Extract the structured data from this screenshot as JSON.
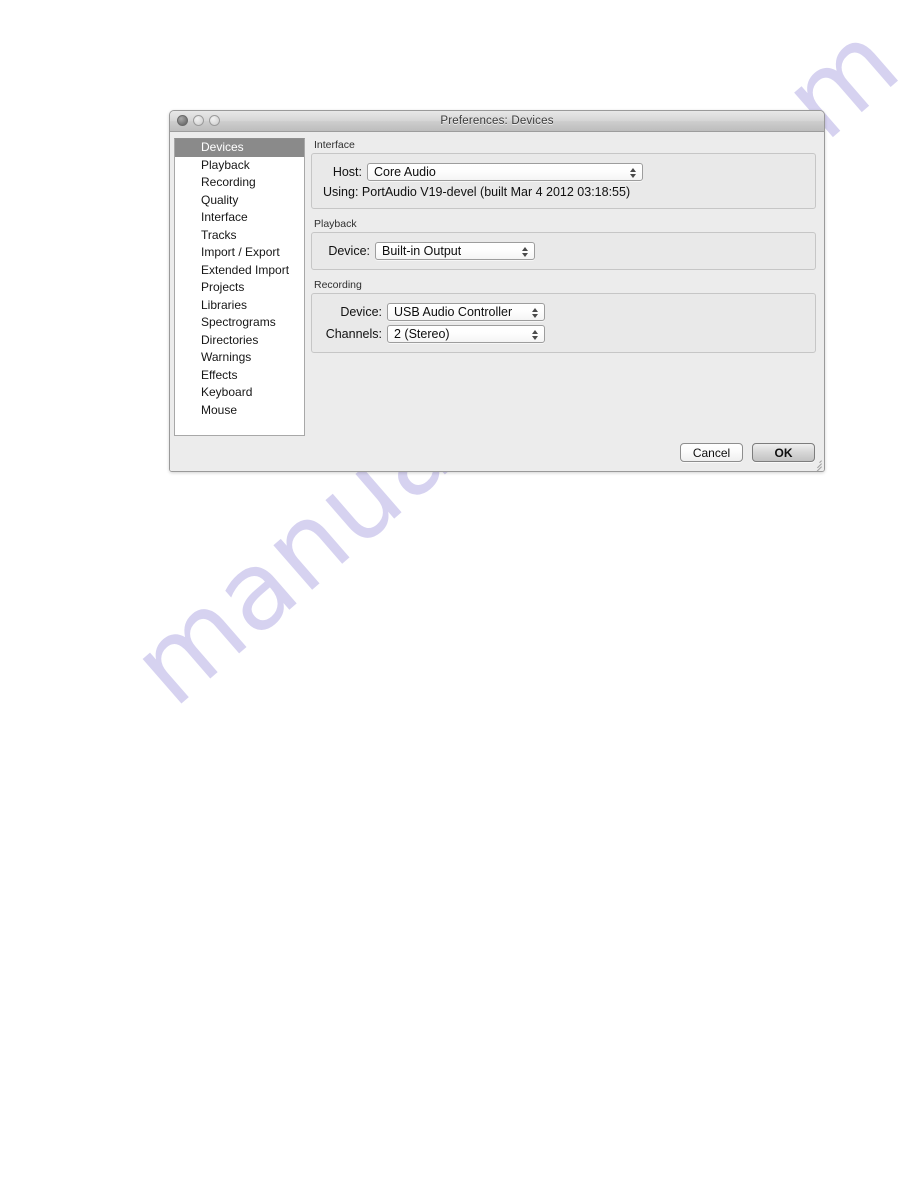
{
  "page": {
    "background_color": "#ffffff",
    "watermark_text": "manualshive.com",
    "watermark_color": "#cfcbee"
  },
  "window": {
    "title": "Preferences: Devices",
    "traffic_lights": {
      "close_label": "close-button",
      "minimize_label": "minimize-button",
      "maximize_label": "maximize-button"
    }
  },
  "sidebar": {
    "selected": "Devices",
    "items": [
      {
        "label": "Devices",
        "selected": true
      },
      {
        "label": "Playback",
        "selected": false
      },
      {
        "label": "Recording",
        "selected": false
      },
      {
        "label": "Quality",
        "selected": false
      },
      {
        "label": "Interface",
        "selected": false
      },
      {
        "label": "Tracks",
        "selected": false
      },
      {
        "label": "Import / Export",
        "selected": false
      },
      {
        "label": "Extended Import",
        "selected": false
      },
      {
        "label": "Projects",
        "selected": false
      },
      {
        "label": "Libraries",
        "selected": false
      },
      {
        "label": "Spectrograms",
        "selected": false
      },
      {
        "label": "Directories",
        "selected": false
      },
      {
        "label": "Warnings",
        "selected": false
      },
      {
        "label": "Effects",
        "selected": false
      },
      {
        "label": "Keyboard",
        "selected": false
      },
      {
        "label": "Mouse",
        "selected": false
      }
    ]
  },
  "content": {
    "interface": {
      "group_label": "Interface",
      "host_label": "Host:",
      "host_value": "Core Audio",
      "using_line": "Using: PortAudio V19-devel (built Mar  4 2012 03:18:55)"
    },
    "playback": {
      "group_label": "Playback",
      "device_label": "Device:",
      "device_value": "Built-in Output"
    },
    "recording": {
      "group_label": "Recording",
      "device_label": "Device:",
      "device_value": "USB Audio Controller",
      "channels_label": "Channels:",
      "channels_value": "2 (Stereo)"
    }
  },
  "buttons": {
    "cancel_label": "Cancel",
    "ok_label": "OK"
  }
}
